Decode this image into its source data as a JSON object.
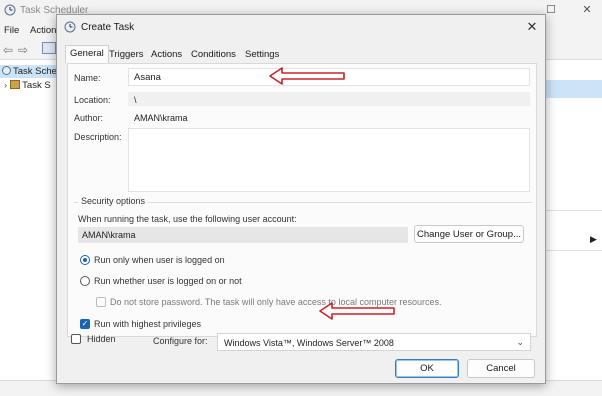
{
  "background_window": {
    "title": "Task Scheduler",
    "menu": [
      "File",
      "Action"
    ],
    "tree_items": [
      "Task Sche",
      "Task S"
    ]
  },
  "dialog": {
    "title": "Create Task",
    "close_glyph": "✕",
    "tabs": [
      "General",
      "Triggers",
      "Actions",
      "Conditions",
      "Settings"
    ],
    "active_tab": "General",
    "general": {
      "name_label": "Name:",
      "name_value": "Asana",
      "location_label": "Location:",
      "location_value": "\\",
      "author_label": "Author:",
      "author_value": "AMAN\\krama",
      "description_label": "Description:",
      "description_value": ""
    },
    "security": {
      "title": "Security options",
      "account_prompt": "When running the task, use the following user account:",
      "account_value": "AMAN\\krama",
      "change_user_button": "Change User or Group...",
      "radio_logged_on": "Run only when user is logged on",
      "radio_logged_on_selected": true,
      "radio_whether": "Run whether user is logged on or not",
      "no_password": "Do not store password.  The task will only have access to local computer resources.",
      "highest_privileges": "Run with highest privileges",
      "highest_privileges_checked": true
    },
    "hidden_label": "Hidden",
    "configure_label": "Configure for:",
    "configure_value": "Windows Vista™, Windows Server™ 2008",
    "ok_button": "OK",
    "cancel_button": "Cancel"
  },
  "colors": {
    "annotation_arrow": "#c8232c",
    "accent": "#1a63b0"
  }
}
